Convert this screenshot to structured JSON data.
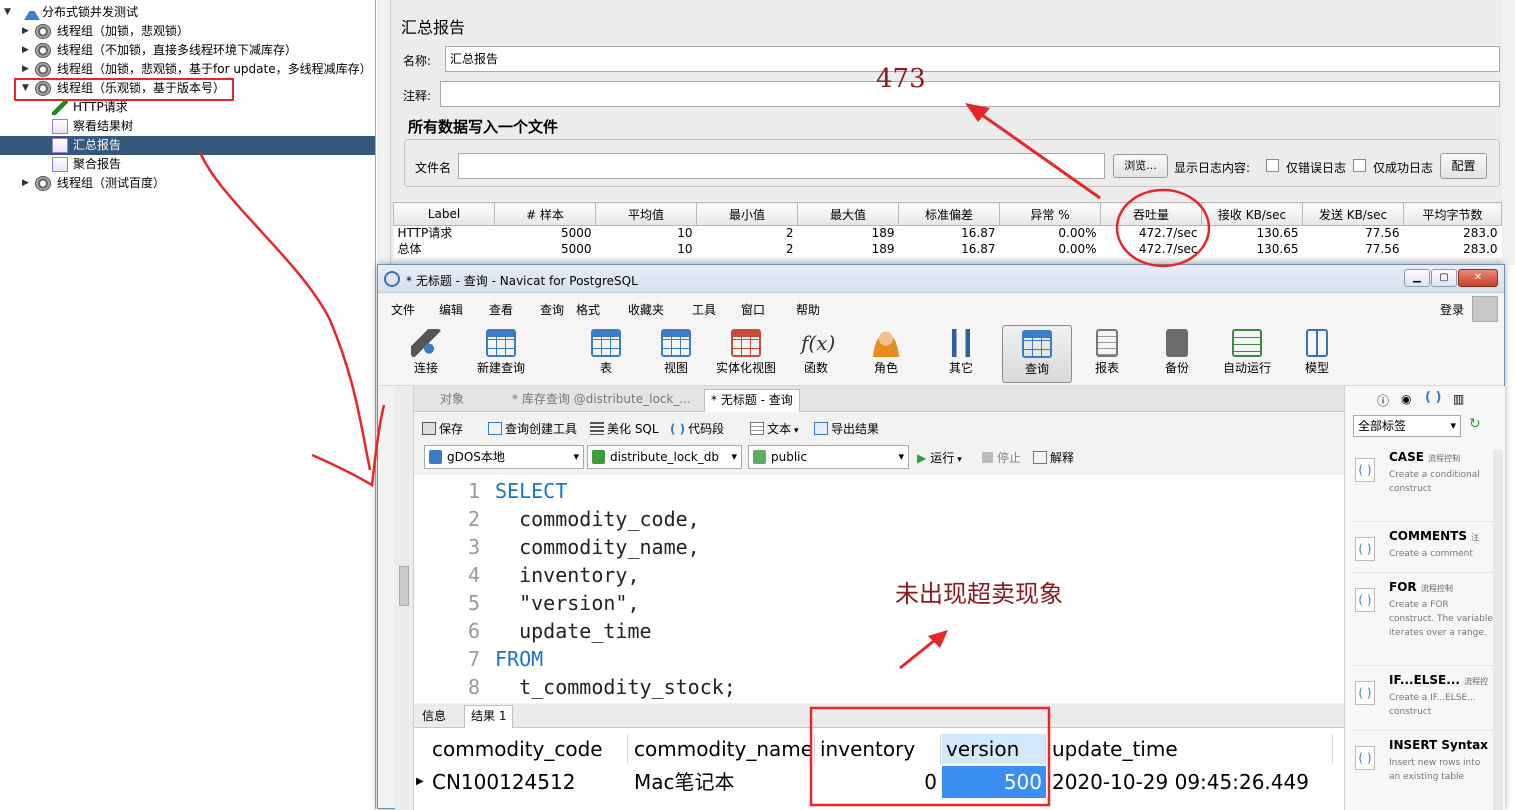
{
  "tree": {
    "root": "分布式锁并发测试",
    "groups": [
      "线程组（加锁，悲观锁）",
      "线程组（不加锁，直接多线程环境下减库存）",
      "线程组（加锁，悲观锁，基于for update，多线程减库存）",
      "线程组（乐观锁，基于版本号）"
    ],
    "children": [
      "HTTP请求",
      "察看结果树",
      "汇总报告",
      "聚合报告"
    ],
    "last_group": "线程组（测试百度）",
    "selected": "汇总报告"
  },
  "report": {
    "title": "汇总报告",
    "name_label": "名称:",
    "name_value": "汇总报告",
    "comment_label": "注释:",
    "comment_value": "",
    "file_group_title": "所有数据写入一个文件",
    "filename_label": "文件名",
    "browse_button": "浏览...",
    "log_display_label": "显示日志内容:",
    "errors_only_label": "仅错误日志",
    "success_only_label": "仅成功日志",
    "configure_button": "配置",
    "columns": [
      "Label",
      "# 样本",
      "平均值",
      "最小值",
      "最大值",
      "标准偏差",
      "异常 %",
      "吞吐量",
      "接收 KB/sec",
      "发送 KB/sec",
      "平均字节数"
    ],
    "rows": [
      [
        "HTTP请求",
        "5000",
        "10",
        "2",
        "189",
        "16.87",
        "0.00%",
        "472.7/sec",
        "130.65",
        "77.56",
        "283.0"
      ],
      [
        "总体",
        "5000",
        "10",
        "2",
        "189",
        "16.87",
        "0.00%",
        "472.7/sec",
        "130.65",
        "77.56",
        "283.0"
      ]
    ]
  },
  "annotations": {
    "throughput_note": "473",
    "no_oversell_note": "未出现超卖现象"
  },
  "navicat": {
    "window_title": "* 无标题 - 查询 - Navicat for PostgreSQL",
    "menu": [
      "文件",
      "编辑",
      "查看",
      "查询",
      "格式",
      "收藏夹",
      "工具",
      "窗口",
      "帮助"
    ],
    "login_label": "登录",
    "toolbar": [
      "连接",
      "新建查询",
      "表",
      "视图",
      "实体化视图",
      "函数",
      "角色",
      "其它",
      "查询",
      "报表",
      "备份",
      "自动运行",
      "模型"
    ],
    "tabs": [
      "对象",
      "* 库存查询 @distribute_lock_...",
      "* 无标题 - 查询"
    ],
    "query_toolbar": {
      "save": "保存",
      "builder": "查询创建工具",
      "beautify": "美化 SQL",
      "snippet": "代码段",
      "text": "文本",
      "export": "导出结果"
    },
    "connection": "gDOS本地",
    "database": "distribute_lock_db",
    "schema": "public",
    "run": "运行",
    "stop": "停止",
    "explain": "解释",
    "sql_lines": [
      {
        "n": "1",
        "text": "SELECT",
        "kw": true
      },
      {
        "n": "2",
        "text": "  commodity_code,",
        "kw": false
      },
      {
        "n": "3",
        "text": "  commodity_name,",
        "kw": false
      },
      {
        "n": "4",
        "text": "  inventory,",
        "kw": false
      },
      {
        "n": "5",
        "text": "  \"version\",",
        "kw": false
      },
      {
        "n": "6",
        "text": "  update_time",
        "kw": false
      },
      {
        "n": "7",
        "text": "FROM",
        "kw": true
      },
      {
        "n": "8",
        "text": "  t_commodity_stock;",
        "kw": false
      }
    ],
    "result_tabs": [
      "信息",
      "结果 1"
    ],
    "grid_columns": [
      "commodity_code",
      "commodity_name",
      "inventory",
      "version",
      "update_time"
    ],
    "grid_row": [
      "CN100124512",
      "Mac笔记本",
      "0",
      "500",
      "2020-10-29 09:45:26.449"
    ],
    "tag_filter": "全部标签",
    "snippets": [
      {
        "title": "CASE",
        "tag": "流程控制",
        "desc": "Create a conditional construct"
      },
      {
        "title": "COMMENTS",
        "tag": "注",
        "desc": "Create a comment"
      },
      {
        "title": "FOR",
        "tag": "流程控制",
        "desc": "Create a FOR construct. The variable iterates over a range."
      },
      {
        "title": "IF...ELSE...",
        "tag": "流程控",
        "desc": "Create a IF...ELSE... construct"
      },
      {
        "title": "INSERT Syntax",
        "tag": "",
        "desc": "Insert new rows into an existing table"
      }
    ]
  },
  "colors": {
    "annotation_red": "#e8262a",
    "tree_selection": "#33587a",
    "sql_keyword": "#1a74d1",
    "cell_highlight": "#3b8ff0"
  }
}
